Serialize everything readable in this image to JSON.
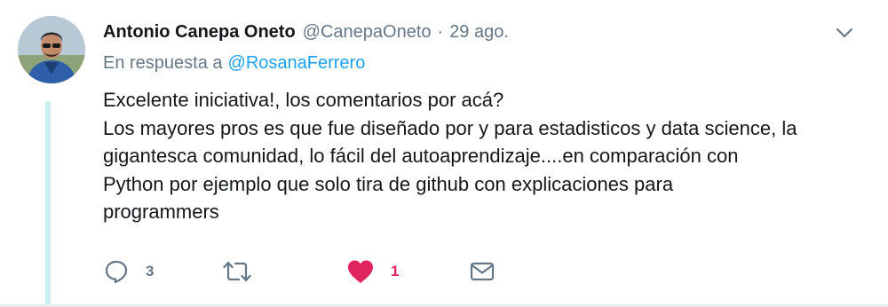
{
  "tweet": {
    "author_name": "Antonio Canepa Oneto",
    "author_handle": "@CanepaOneto",
    "separator": "·",
    "timestamp": "29 ago.",
    "reply_prefix": "En respuesta a",
    "reply_to_handle": "@RosanaFerrero",
    "body_lines": [
      "Excelente iniciativa!, los comentarios por acá?",
      "Los mayores pros es que fue diseñado por y para estadisticos y data science, la",
      "gigantesca comunidad, lo fácil del autoaprendizaje....en comparación con",
      "Python por ejemplo que solo tira de github con explicaciones para",
      "programmers"
    ]
  },
  "actions": {
    "reply_count": "3",
    "retweet_count": "",
    "like_count": "1",
    "liked": true
  },
  "icons": {
    "caret": "chevron-down-icon",
    "reply": "speech-bubble-icon",
    "retweet": "retweet-icon",
    "like": "heart-icon",
    "message": "envelope-icon"
  },
  "colors": {
    "text": "#14171a",
    "muted": "#657786",
    "link": "#1da1f2",
    "like": "#e0245e",
    "thread_line": "#ccf0f2"
  }
}
